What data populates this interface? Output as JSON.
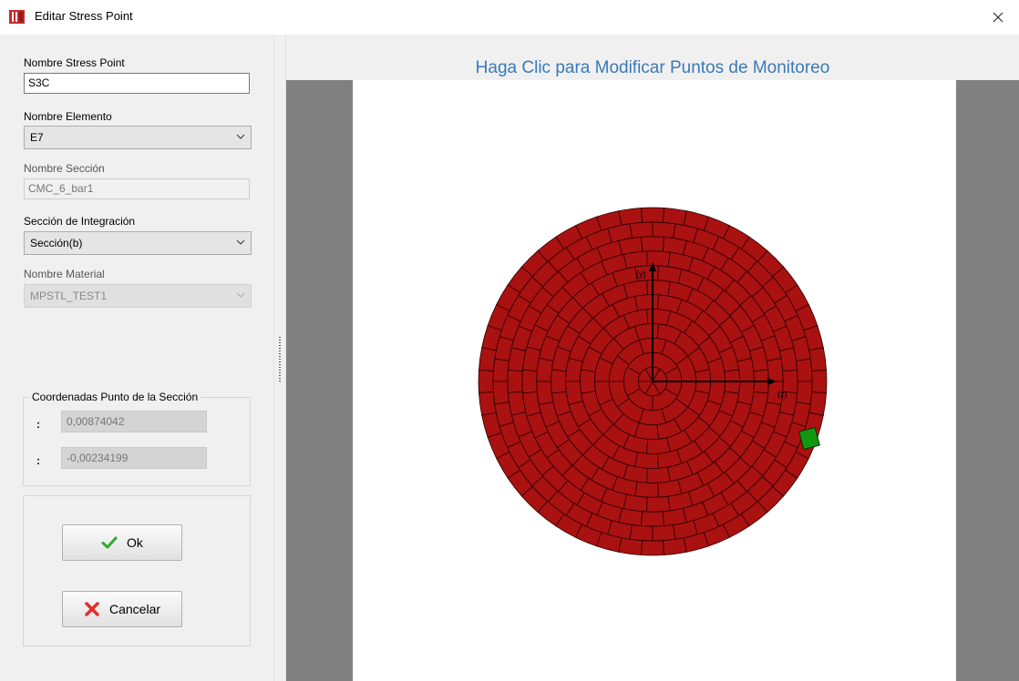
{
  "window": {
    "title": "Editar Stress Point",
    "close_glyph": "×",
    "icon": "app-book-icon"
  },
  "form": {
    "stress_point_label": "Nombre Stress Point",
    "stress_point_value": "S3C",
    "element_label": "Nombre Elemento",
    "element_value": "E7",
    "section_label": "Nombre Sección",
    "section_value": "CMC_6_bar1",
    "integration_label": "Sección de Integración",
    "integration_value": "Sección(b)",
    "material_label": "Nombre Material",
    "material_value": "MPSTL_TEST1"
  },
  "coords": {
    "title": "Coordenadas Punto de la Sección",
    "colon": ":",
    "y_value": "0,00874042",
    "z_value": "-0,00234199"
  },
  "buttons": {
    "ok_label": "Ok",
    "cancel_label": "Cancelar"
  },
  "view": {
    "heading": "Haga Clic para Modificar Puntos de Monitoreo",
    "axis_vertical_label": "(y)",
    "axis_horizontal_label": "(z)"
  },
  "section_mesh": {
    "rings": 12,
    "fiber_color": "#aa1111",
    "selected_color": "#119911",
    "selected_fiber": {
      "ring": 11,
      "angle_deg": -20
    }
  },
  "colors": {
    "heading": "#3a7ab8",
    "ok_check": "#2eaa2e",
    "cancel_x": "#e0302a",
    "canvas_bg": "#ffffff",
    "canvas_margin": "#808080"
  }
}
